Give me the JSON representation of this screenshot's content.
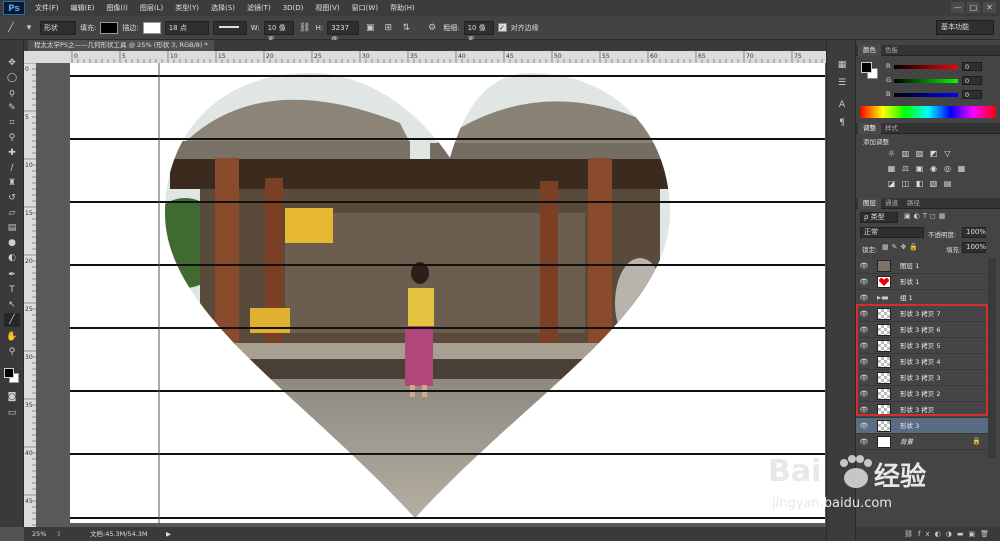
{
  "app": {
    "logo": "Ps",
    "menu": [
      "文件(F)",
      "编辑(E)",
      "图像(I)",
      "图层(L)",
      "类型(Y)",
      "选择(S)",
      "滤镜(T)",
      "3D(D)",
      "视图(V)",
      "窗口(W)",
      "帮助(H)"
    ],
    "window_buttons": [
      "—",
      "□",
      "✕"
    ]
  },
  "options": {
    "mode": "形状",
    "fill_label": "填充:",
    "stroke_label": "描边:",
    "stroke_size": "18 点",
    "w_label": "W:",
    "w_value": "10 像素",
    "h_label": "H:",
    "h_value": "3237 像",
    "weight_label": "粗细:",
    "weight_value": "10 像素",
    "align_edges_label": "对齐边缘",
    "align_edges_checked": true,
    "workspace": "基本功能"
  },
  "document": {
    "tab_title": "程太太学PS之——几何形状工具 @ 25% (形状 3, RGB/8) *",
    "zoom": "25%",
    "doc_size": "文档:45.3M/54.3M",
    "ruler_top_labels": [
      "0",
      "5",
      "10",
      "15",
      "20",
      "25",
      "30",
      "35",
      "40",
      "45",
      "50",
      "55",
      "60",
      "65",
      "70",
      "75"
    ],
    "ruler_left_labels": [
      "0",
      "5",
      "10",
      "15",
      "20",
      "25",
      "30",
      "35",
      "40",
      "45"
    ]
  },
  "color_panel": {
    "tabs": [
      "颜色",
      "色板"
    ],
    "channels": [
      {
        "label": "R",
        "value": "0"
      },
      {
        "label": "G",
        "value": "0"
      },
      {
        "label": "B",
        "value": "0"
      }
    ]
  },
  "adjust_panel": {
    "tabs": [
      "调整",
      "样式"
    ],
    "title": "添加调整"
  },
  "layers_panel": {
    "tabs": [
      "图层",
      "通道",
      "路径"
    ],
    "filter": "ρ 类型",
    "blend_mode": "正常",
    "opacity_label": "不透明度:",
    "opacity_value": "100%",
    "lock_label": "锁定:",
    "fill_label": "填充:",
    "fill_value": "100%",
    "layers": [
      {
        "name": "图层 1",
        "thumb": "photo",
        "selected": false
      },
      {
        "name": "形状 1",
        "thumb": "heart",
        "selected": false
      },
      {
        "name": "组 1",
        "thumb": "folder",
        "selected": false
      },
      {
        "name": "形状 3 拷贝 7",
        "thumb": "shape",
        "selected": false
      },
      {
        "name": "形状 3 拷贝 6",
        "thumb": "shape",
        "selected": false
      },
      {
        "name": "形状 3 拷贝 5",
        "thumb": "shape",
        "selected": false
      },
      {
        "name": "形状 3 拷贝 4",
        "thumb": "shape",
        "selected": false
      },
      {
        "name": "形状 3 拷贝 3",
        "thumb": "shape",
        "selected": false
      },
      {
        "name": "形状 3 拷贝 2",
        "thumb": "shape",
        "selected": false
      },
      {
        "name": "形状 3 拷贝",
        "thumb": "shape",
        "selected": false
      },
      {
        "name": "形状 3",
        "thumb": "shape",
        "selected": true
      },
      {
        "name": "背景",
        "thumb": "white",
        "selected": false
      }
    ],
    "highlight_color": "#d0312d"
  },
  "watermark": {
    "brand": "Bai",
    "brand2": "经验",
    "url": "jingyan.baidu.com"
  }
}
